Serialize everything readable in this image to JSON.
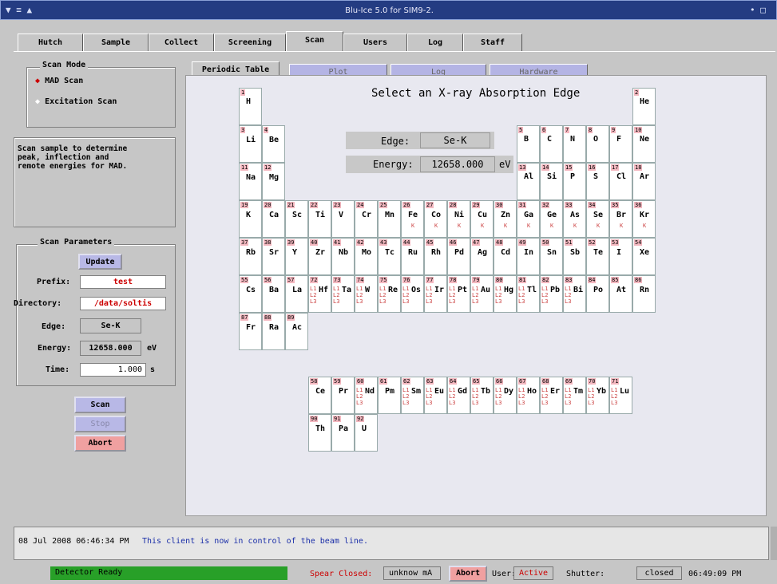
{
  "window": {
    "title": "Blu-Ice 5.0 for SIM9-2."
  },
  "tabs": [
    "Hutch",
    "Sample",
    "Collect",
    "Screening",
    "Scan",
    "Users",
    "Log",
    "Staff"
  ],
  "scan_mode": {
    "legend": "Scan Mode",
    "options": [
      {
        "label": "MAD Scan",
        "selected": true
      },
      {
        "label": "Excitation Scan",
        "selected": false
      }
    ]
  },
  "description": "Scan sample to determine\npeak, inflection and\nremote energies for MAD.",
  "scan_params": {
    "legend": "Scan Parameters",
    "update": "Update",
    "prefix_label": "Prefix:",
    "prefix": "test",
    "directory_label": "Directory:",
    "directory": "/data/soltis",
    "edge_label": "Edge:",
    "edge": "Se-K",
    "energy_label": "Energy:",
    "energy": "12658.000",
    "energy_unit": "eV",
    "time_label": "Time:",
    "time": "1.000",
    "time_unit": "s"
  },
  "actions": {
    "scan": "Scan",
    "stop": "Stop",
    "abort": "Abort"
  },
  "subtabs": [
    "Periodic Table",
    "Plot",
    "Log",
    "Hardware"
  ],
  "periodic": {
    "heading": "Select an X-ray Absorption Edge",
    "edge_label": "Edge:",
    "edge_value": "Se-K",
    "energy_label": "Energy:",
    "energy_value": "12658.000",
    "energy_unit": "eV"
  },
  "log": {
    "timestamp": "08 Jul 2008 06:46:34 PM",
    "message": "This client is now in control of the beam line."
  },
  "status": {
    "detector": "Detector Ready",
    "spear_label": "Spear Closed:",
    "spear_value": "unknow",
    "spear_unit": "mA",
    "abort": "Abort",
    "user_label": "User:",
    "user_value": "Active",
    "shutter_label": "Shutter:",
    "shutter_value": "closed",
    "time": "06:49:09 PM"
  },
  "colors": {
    "title_bg": "#243c82",
    "detector_green": "#28a028",
    "abort_red": "#f0a0a0",
    "sel_blue": "#b8b8e6"
  }
}
